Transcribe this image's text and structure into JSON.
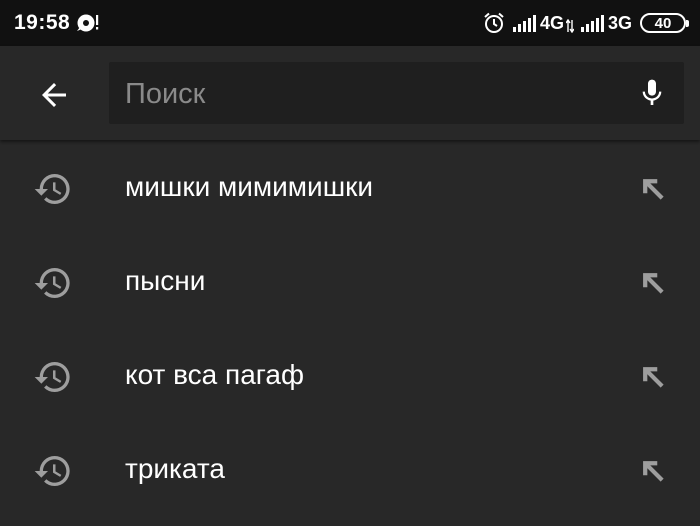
{
  "status_bar": {
    "time": "19:58",
    "network_1": "4G",
    "network_2": "3G",
    "battery": "40",
    "icons": [
      "app-notification-icon",
      "alarm-icon",
      "signal-icon",
      "data-arrows-icon",
      "signal-icon",
      "battery-icon"
    ]
  },
  "app_bar": {
    "back_icon": "back-arrow-icon",
    "search_placeholder": "Поиск",
    "search_value": "",
    "mic_icon": "microphone-icon"
  },
  "suggestions": [
    {
      "text": "мишки мимимишки",
      "icon": "history-icon",
      "action_icon": "fill-query-arrow-icon"
    },
    {
      "text": "пысни",
      "icon": "history-icon",
      "action_icon": "fill-query-arrow-icon"
    },
    {
      "text": "кот вса пагаф",
      "icon": "history-icon",
      "action_icon": "fill-query-arrow-icon"
    },
    {
      "text": "триката",
      "icon": "history-icon",
      "action_icon": "fill-query-arrow-icon"
    }
  ],
  "colors": {
    "background": "#282828",
    "status_bar": "#111111",
    "search_field": "#1f1f1f",
    "secondary_icon": "#9e9e9e",
    "placeholder": "#8a8a8a",
    "text": "#ffffff"
  }
}
